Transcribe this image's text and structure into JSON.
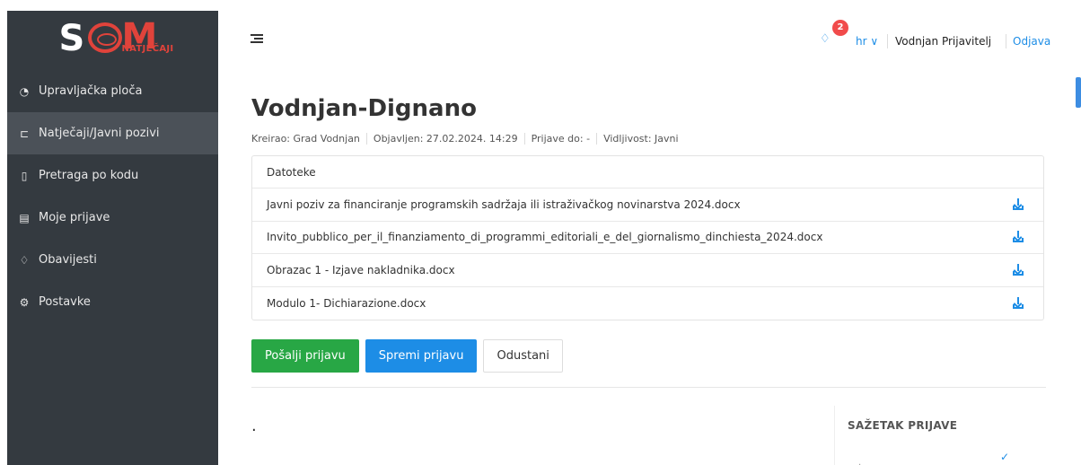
{
  "logo": {
    "name_left": "S",
    "name_right": "M",
    "subtitle": "NATJEČAJI"
  },
  "sidebar": {
    "items": [
      {
        "label": "Upravljačka ploča",
        "icon": "chart-pie-icon",
        "glyph": "◔",
        "active": false
      },
      {
        "label": "Natječaji/Javni pozivi",
        "icon": "folder-open-icon",
        "glyph": "⊏",
        "active": true
      },
      {
        "label": "Pretraga po kodu",
        "icon": "document-icon",
        "glyph": "▯",
        "active": false
      },
      {
        "label": "Moje prijave",
        "icon": "file-text-icon",
        "glyph": "▤",
        "active": false
      },
      {
        "label": "Obavijesti",
        "icon": "bell-icon",
        "glyph": "♢",
        "active": false
      },
      {
        "label": "Postavke",
        "icon": "gear-icon",
        "glyph": "⚙",
        "active": false
      }
    ]
  },
  "topbar": {
    "notification_count": "2",
    "language": "hr ∨",
    "user_name": "Vodnjan Prijavitelj",
    "logout_label": "Odjava"
  },
  "page": {
    "title": "Vodnjan-Dignano",
    "meta": {
      "created_by": "Kreirao: Grad Vodnjan",
      "published": "Objavljen: 27.02.2024. 14:29",
      "deadline": "Prijave do: -",
      "visibility": "Vidljivost: Javni"
    }
  },
  "files": {
    "header": "Datoteke",
    "items": [
      "Javni poziv za financiranje programskih sadržaja ili istraživačkog novinarstva 2024.docx",
      "Invito_pubblico_per_il_finanziamento_di_programmi_editoriali_e_del_giornalismo_dinchiesta_2024.docx",
      "Obrazac 1 - Izjave nakladnika.docx",
      "Modulo 1- Dichiarazione.docx"
    ]
  },
  "actions": {
    "submit_label": "Pošalji prijavu",
    "save_label": "Spremi prijavu",
    "cancel_label": "Odustani"
  },
  "form": {
    "placeholder_dot": "."
  },
  "summary": {
    "title": "SAŽETAK PRIJAVE",
    "check": "✓",
    "faint": "."
  },
  "colors": {
    "sidebar_bg": "#343a40",
    "sidebar_active": "#4b5158",
    "brand_red": "#e0433b",
    "primary_blue": "#1d8de6",
    "success_green": "#28a745",
    "badge_red": "#f14b4b"
  }
}
